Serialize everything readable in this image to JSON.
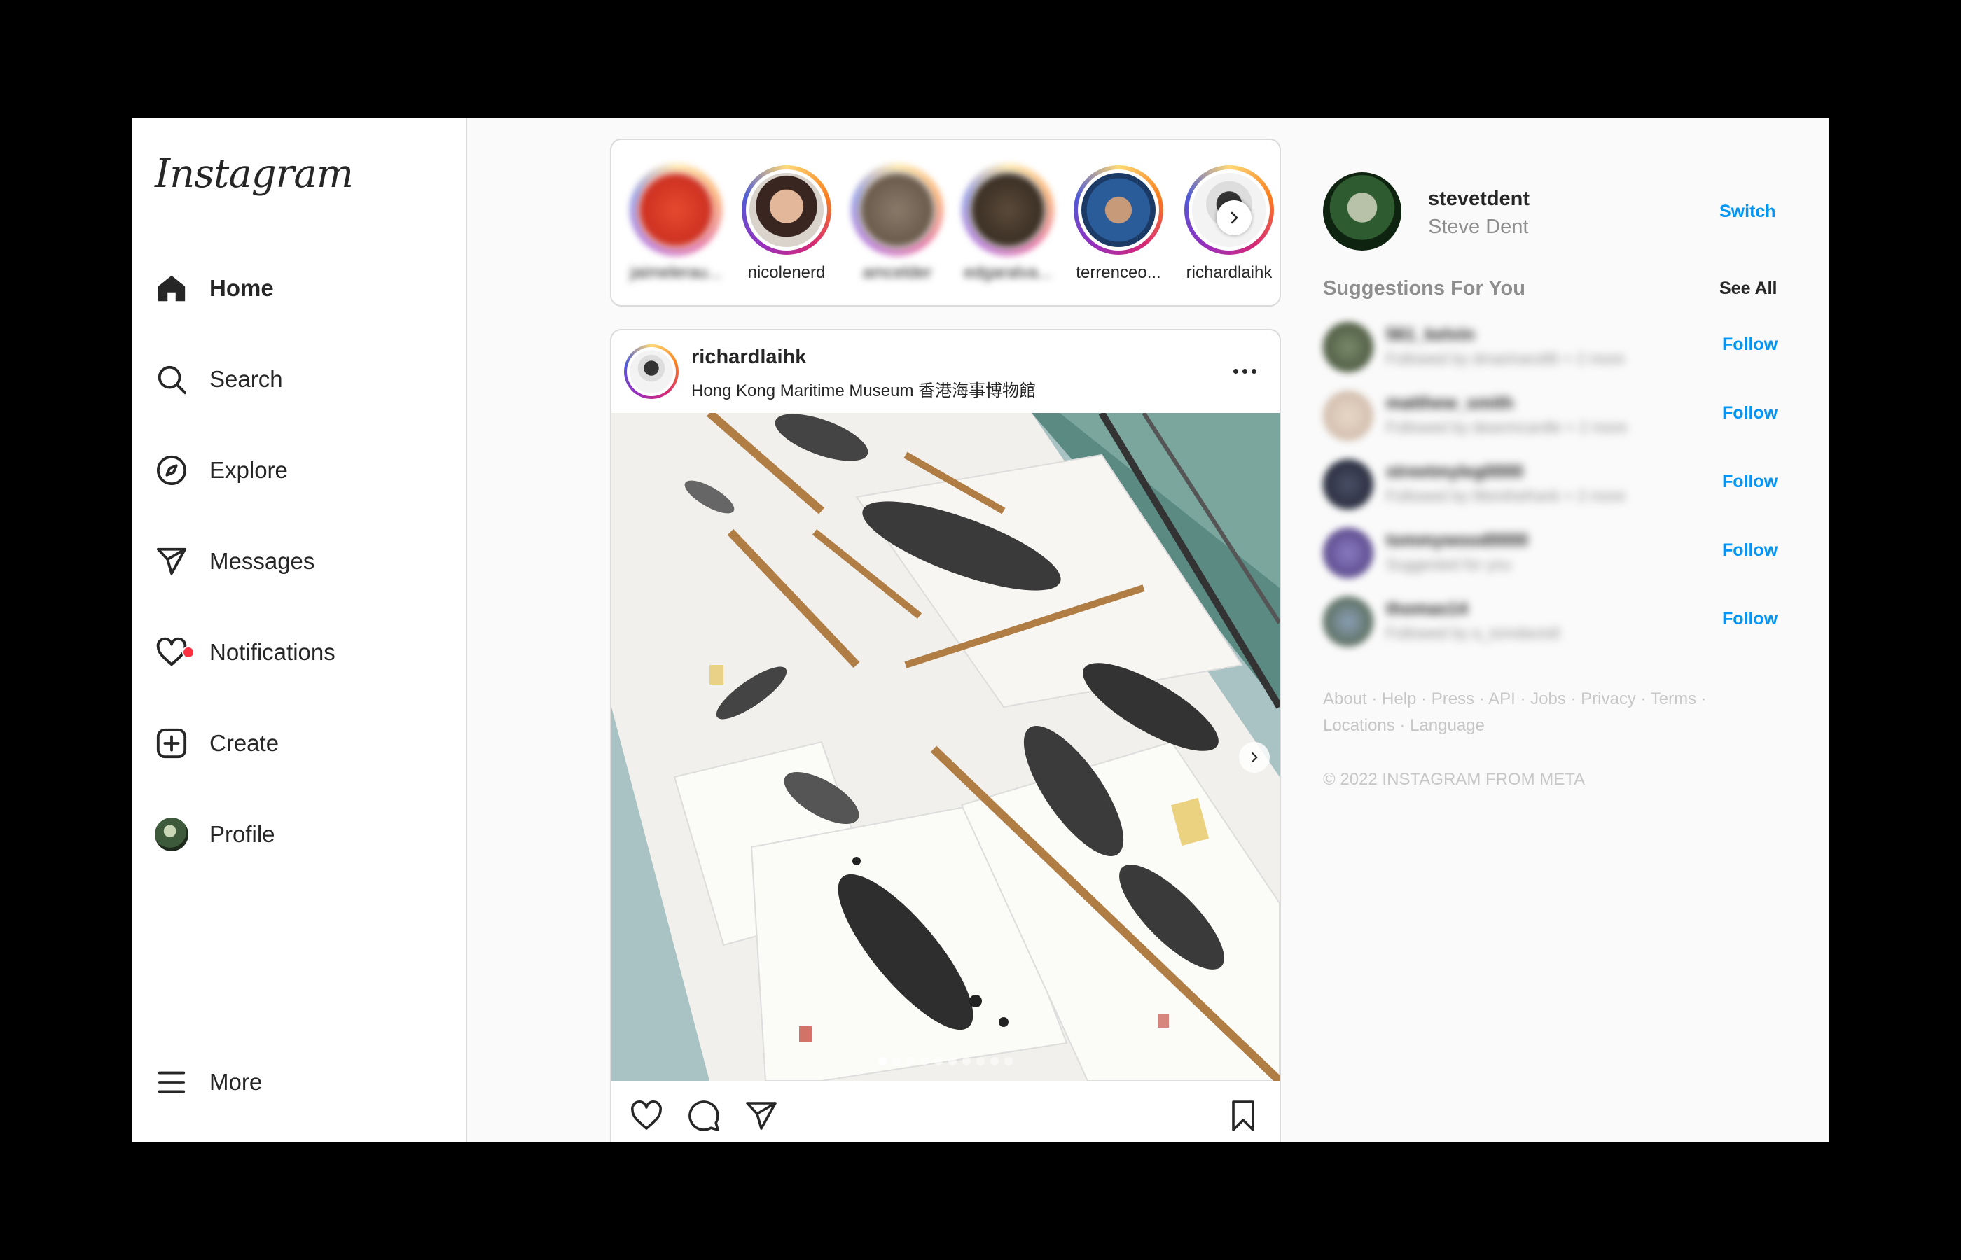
{
  "app": {
    "logo": "Instagram"
  },
  "nav": {
    "home": "Home",
    "search": "Search",
    "explore": "Explore",
    "messages": "Messages",
    "notifications": "Notifications",
    "create": "Create",
    "profile": "Profile",
    "more": "More"
  },
  "stories": [
    {
      "name": "jaimelerau...",
      "blurred": true
    },
    {
      "name": "nicolenerd",
      "blurred": false
    },
    {
      "name": "amcelder",
      "blurred": true
    },
    {
      "name": "edgaralva...",
      "blurred": true
    },
    {
      "name": "terrenceo...",
      "blurred": false
    },
    {
      "name": "richardlaihk",
      "blurred": false
    }
  ],
  "post": {
    "username": "richardlaihk",
    "location": "Hong Kong Maritime Museum 香港海事博物館",
    "carousel_slides": 10,
    "carousel_current": 1
  },
  "account": {
    "username": "stevetdent",
    "full_name": "Steve Dent",
    "switch_label": "Switch"
  },
  "suggestions": {
    "title": "Suggestions For You",
    "see_all": "See All",
    "follow_label": "Follow",
    "items": [
      {
        "username": "561_kelvin",
        "subtitle": "Followed by dmarinaro86 + 2 more"
      },
      {
        "username": "matthew_smith",
        "subtitle": "Followed by deanmcardle + 2 more"
      },
      {
        "username": "streetmyleg0000",
        "subtitle": "Followed by lifeinthefrank + 2 more"
      },
      {
        "username": "tommywood0000",
        "subtitle": "Suggested for you"
      },
      {
        "username": "thomas14",
        "subtitle": "Followed by a_tomdavis8"
      }
    ]
  },
  "footer": {
    "links": [
      "About",
      "Help",
      "Press",
      "API",
      "Jobs",
      "Privacy",
      "Terms",
      "Locations",
      "Language"
    ],
    "copyright": "© 2022 INSTAGRAM FROM META"
  }
}
